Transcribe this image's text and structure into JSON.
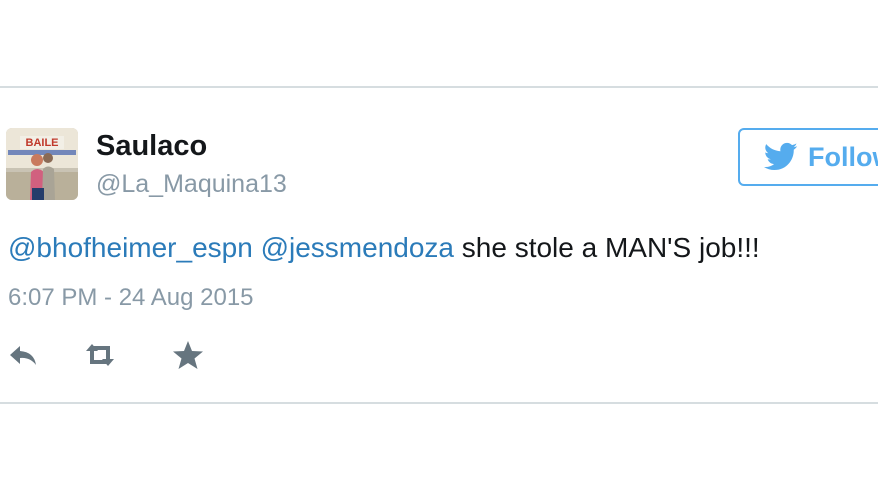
{
  "tweet": {
    "author": {
      "display_name": "Saulaco",
      "handle": "@La_Maquina13",
      "avatar_sign_text": "BAILE"
    },
    "follow_button": {
      "label": "Follow",
      "icon": "twitter-bird-icon"
    },
    "text": {
      "mention_1": "@bhofheimer_espn",
      "mention_2": "@jessmendoza",
      "body": "she stole a MAN'S job!!!"
    },
    "timestamp": "6:07 PM - 24 Aug 2015",
    "actions": [
      {
        "name": "reply",
        "icon": "reply-icon"
      },
      {
        "name": "retweet",
        "icon": "retweet-icon"
      },
      {
        "name": "favorite",
        "icon": "star-icon"
      }
    ]
  },
  "colors": {
    "link": "#2b7bb9",
    "accent": "#55acee",
    "muted": "#8899a6",
    "text": "#14171a",
    "divider": "#d6dde0",
    "action_icon": "#66757f"
  }
}
